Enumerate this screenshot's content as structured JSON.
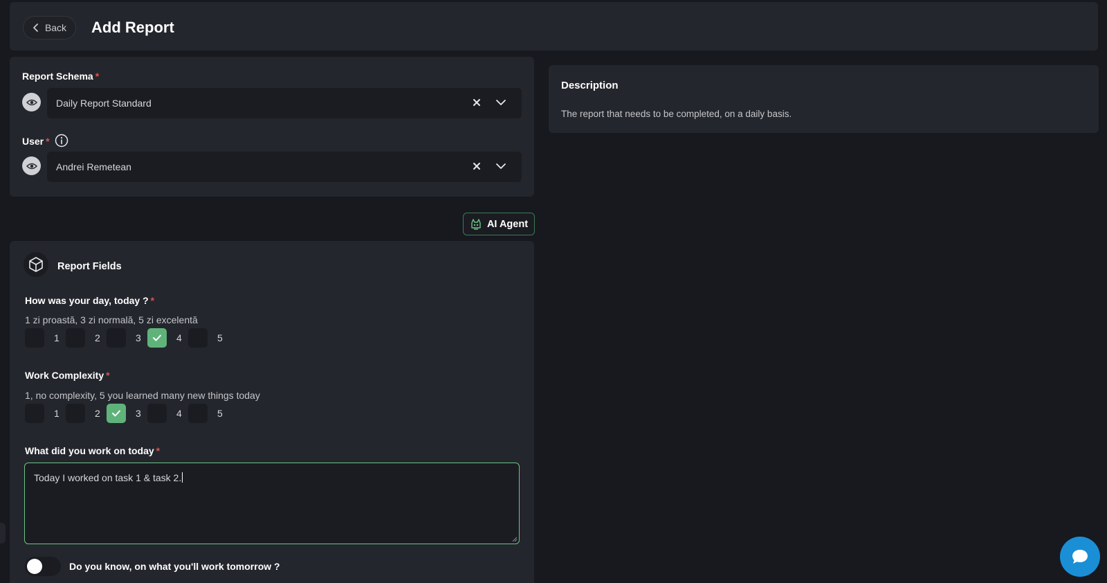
{
  "header": {
    "back_label": "Back",
    "title": "Add Report"
  },
  "report_schema": {
    "label": "Report Schema",
    "required_mark": "*",
    "value": "Daily Report Standard"
  },
  "user": {
    "label": "User",
    "required_mark": "*",
    "value": "Andrei Remetean"
  },
  "description": {
    "title": "Description",
    "text": "The report that needs to be completed, on a daily basis."
  },
  "ai_agent": {
    "label": "AI Agent"
  },
  "report_fields": {
    "title": "Report Fields",
    "questions": [
      {
        "label": "How was your day, today ?",
        "required_mark": "*",
        "help": "1 zi proastă, 3 zi normală, 5 zi excelentă",
        "options": [
          "1",
          "2",
          "3",
          "4",
          "5"
        ],
        "selected": "4"
      },
      {
        "label": "Work Complexity",
        "required_mark": "*",
        "help": "1, no complexity, 5 you learned many new things today",
        "options": [
          "1",
          "2",
          "3",
          "4",
          "5"
        ],
        "selected": "3"
      }
    ],
    "work_today": {
      "label": "What did you work on today",
      "required_mark": "*",
      "value": "Today I worked on task 1 & task 2."
    },
    "tomorrow_toggle": {
      "label": "Do you know, on what you'll work tomorrow ?",
      "on": false
    }
  },
  "colors": {
    "accent_green": "#5fb37a",
    "required_red": "#d9534f",
    "chat_blue": "#1a8fd6"
  },
  "icons": {
    "back": "chevron-left-icon",
    "eye": "eye-icon",
    "clear": "close-icon",
    "chevron": "chevron-down-icon",
    "info": "info-icon",
    "ai": "robot-icon",
    "fields": "cube-icon",
    "check": "checkmark-icon",
    "chat": "chat-bubble-icon"
  }
}
